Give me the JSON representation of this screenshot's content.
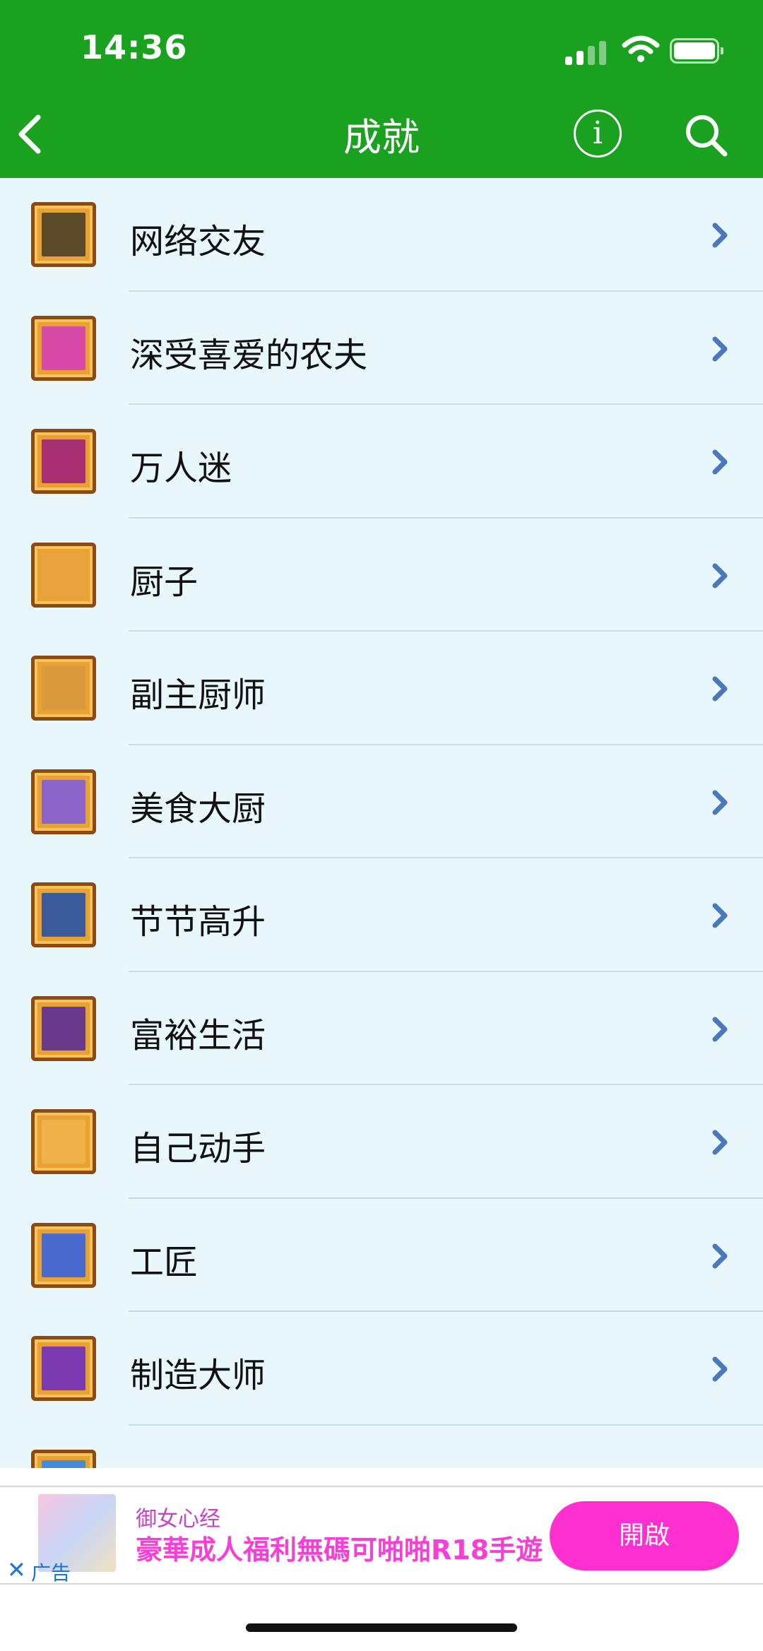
{
  "status_bar": {
    "time": "14:36"
  },
  "nav": {
    "title": "成就",
    "info_label": "i"
  },
  "achievements": [
    {
      "label": "网络交友",
      "icon": "social-icon",
      "art": "#5a4a2a"
    },
    {
      "label": "深受喜爱的农夫",
      "icon": "hearts-icon",
      "art": "#d84aa8"
    },
    {
      "label": "万人迷",
      "icon": "many-hearts-icon",
      "art": "#a83070"
    },
    {
      "label": "厨子",
      "icon": "utensils-icon",
      "art": "#e9a440"
    },
    {
      "label": "副主厨师",
      "icon": "pot-icon",
      "art": "#d89a3a"
    },
    {
      "label": "美食大厨",
      "icon": "chef-icon",
      "art": "#8a64c8"
    },
    {
      "label": "节节高升",
      "icon": "house-icon",
      "art": "#3a5a9a"
    },
    {
      "label": "富裕生活",
      "icon": "mansion-icon",
      "art": "#6a3a8a"
    },
    {
      "label": "自己动手",
      "icon": "hammer-icon",
      "art": "#f0b34a"
    },
    {
      "label": "工匠",
      "icon": "crossed-hammers-icon",
      "art": "#4a6ad0"
    },
    {
      "label": "制造大师",
      "icon": "golden-hammers-icon",
      "art": "#7a3ab0"
    }
  ],
  "ad": {
    "tag": "广告",
    "subtitle": "御女心经",
    "title": "豪華成人福利無碼可啪啪R18手遊",
    "button": "開啟"
  }
}
